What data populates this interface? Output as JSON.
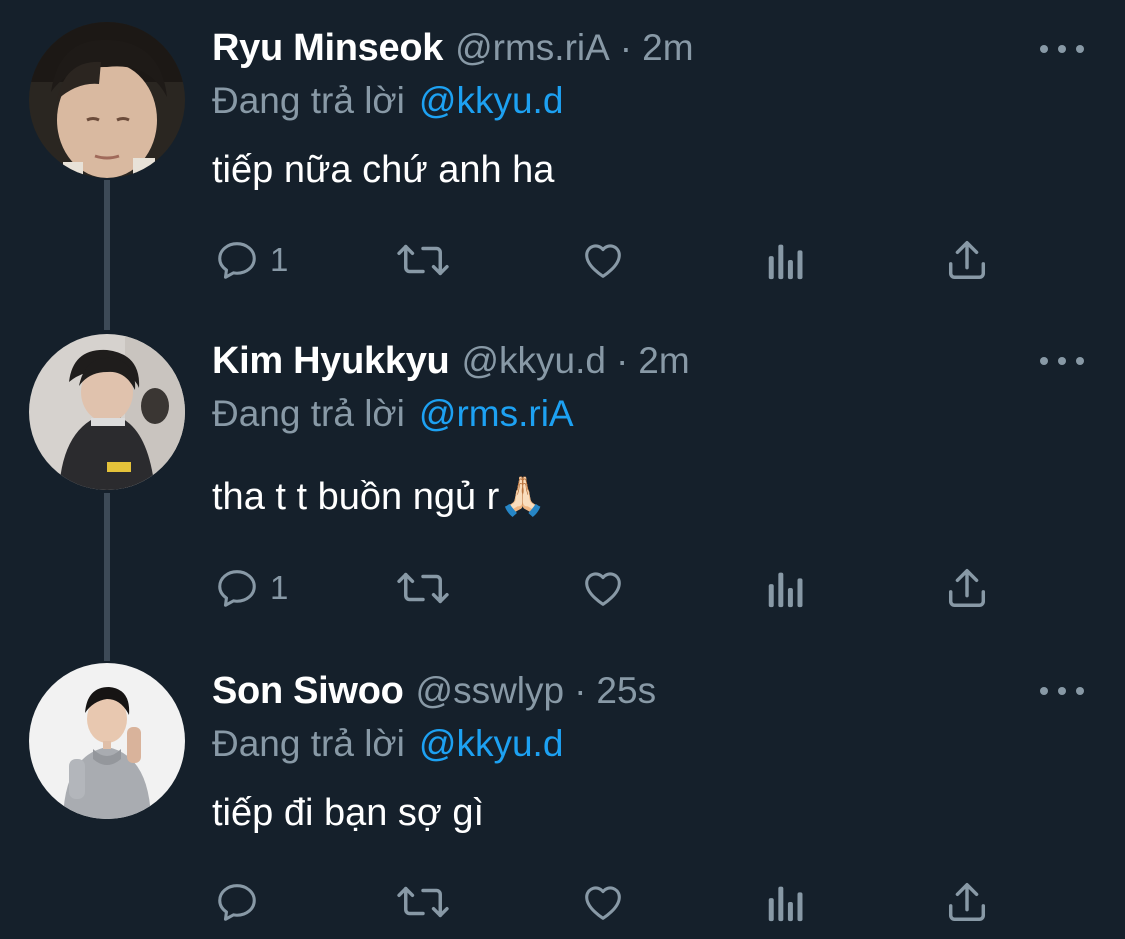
{
  "reply_prefix": "Đang trả lời",
  "tweets": [
    {
      "name": "Ryu Minseok",
      "handle": "@rms.riA",
      "time": "2m",
      "reply_to": "@kkyu.d",
      "text": "tiếp nữa chứ anh ha",
      "reply_count": "1"
    },
    {
      "name": "Kim Hyukkyu",
      "handle": "@kkyu.d",
      "time": "2m",
      "reply_to": "@rms.riA",
      "text": "tha t t buồn ngủ r🙏🏻",
      "reply_count": "1"
    },
    {
      "name": "Son Siwoo",
      "handle": "@sswlyp",
      "time": "25s",
      "reply_to": "@kkyu.d",
      "text": "tiếp đi bạn sợ gì",
      "reply_count": ""
    }
  ],
  "separator": "·",
  "icons": {
    "reply": "reply-icon",
    "retweet": "retweet-icon",
    "like": "heart-icon",
    "analytics": "analytics-icon",
    "share": "share-icon",
    "more": "more-icon"
  },
  "colors": {
    "background": "#15202b",
    "name": "#ffffff",
    "secondary": "#8899a6",
    "mention": "#1da1f2",
    "thread_line": "#3d4a57"
  }
}
